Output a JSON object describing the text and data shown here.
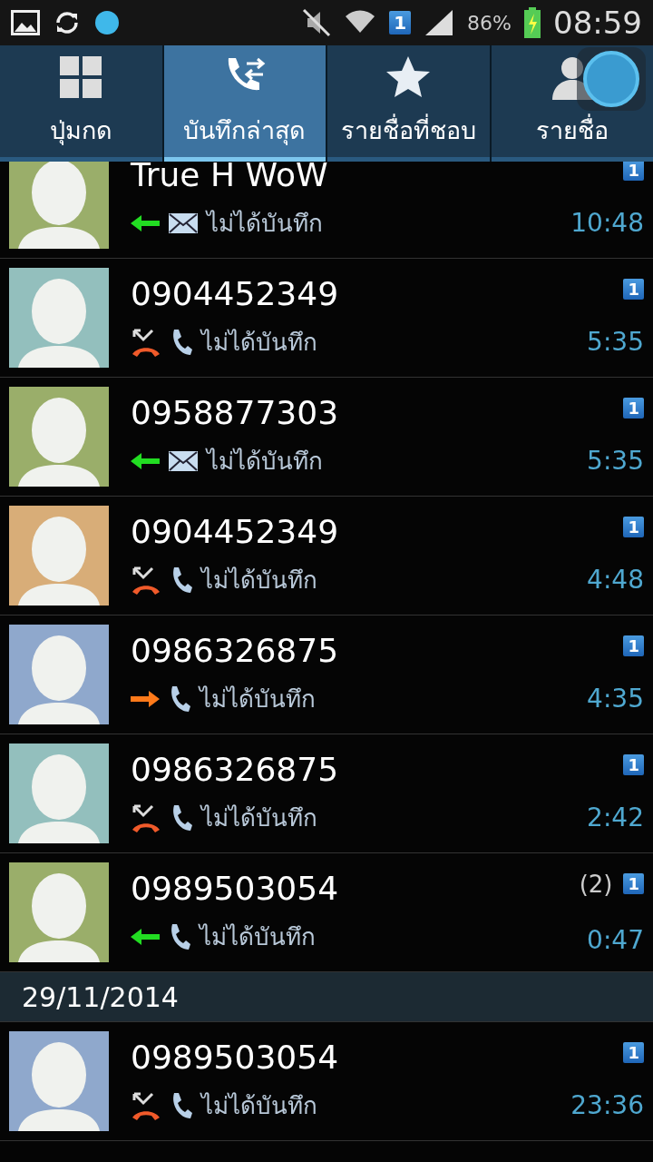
{
  "status_bar": {
    "sim": "1",
    "battery": "86%",
    "time": "08:59"
  },
  "tabs": [
    {
      "label": "ปุ่มกด",
      "kind": "keypad",
      "selected": false
    },
    {
      "label": "บันทึกล่าสุด",
      "kind": "log",
      "selected": true
    },
    {
      "label": "รายชื่อที่ชอบ",
      "kind": "favorites",
      "selected": false
    },
    {
      "label": "รายชื่อ",
      "kind": "contacts",
      "selected": false
    }
  ],
  "sections": [
    {
      "calls": [
        {
          "name": "True H WoW",
          "icons": [
            {
              "kind": "incoming"
            },
            {
              "kind": "message"
            }
          ],
          "note": "ไม่ได้บันทึก",
          "time": "10:48",
          "sim": "1",
          "color": "#9aae6a"
        },
        {
          "name": "0904452349",
          "icons": [
            {
              "kind": "missed"
            },
            {
              "kind": "call"
            }
          ],
          "note": "ไม่ได้บันทึก",
          "time": "5:35",
          "sim": "1",
          "color": "#93bfbd"
        },
        {
          "name": "0958877303",
          "icons": [
            {
              "kind": "incoming"
            },
            {
              "kind": "message"
            }
          ],
          "note": "ไม่ได้บันทึก",
          "time": "5:35",
          "sim": "1",
          "color": "#9aae6a"
        },
        {
          "name": "0904452349",
          "icons": [
            {
              "kind": "missed"
            },
            {
              "kind": "call"
            }
          ],
          "note": "ไม่ได้บันทึก",
          "time": "4:48",
          "sim": "1",
          "color": "#d8ad78"
        },
        {
          "name": "0986326875",
          "icons": [
            {
              "kind": "outgoing"
            },
            {
              "kind": "call"
            }
          ],
          "note": "ไม่ได้บันทึก",
          "time": "4:35",
          "sim": "1",
          "color": "#8fa8cc"
        },
        {
          "name": "0986326875",
          "icons": [
            {
              "kind": "missed"
            },
            {
              "kind": "call"
            }
          ],
          "note": "ไม่ได้บันทึก",
          "time": "2:42",
          "sim": "1",
          "color": "#93bfbd"
        },
        {
          "name": "0989503054",
          "icons": [
            {
              "kind": "incoming"
            },
            {
              "kind": "call"
            }
          ],
          "note": "ไม่ได้บันทึก",
          "time": "0:47",
          "sim": "1",
          "count": "(2)",
          "color": "#9aae6a"
        }
      ]
    },
    {
      "date": "29/11/2014",
      "calls": [
        {
          "name": "0989503054",
          "icons": [
            {
              "kind": "missed"
            },
            {
              "kind": "call"
            }
          ],
          "note": "ไม่ได้บันทึก",
          "time": "23:36",
          "sim": "1",
          "color": "#8fa8cc"
        }
      ]
    }
  ]
}
